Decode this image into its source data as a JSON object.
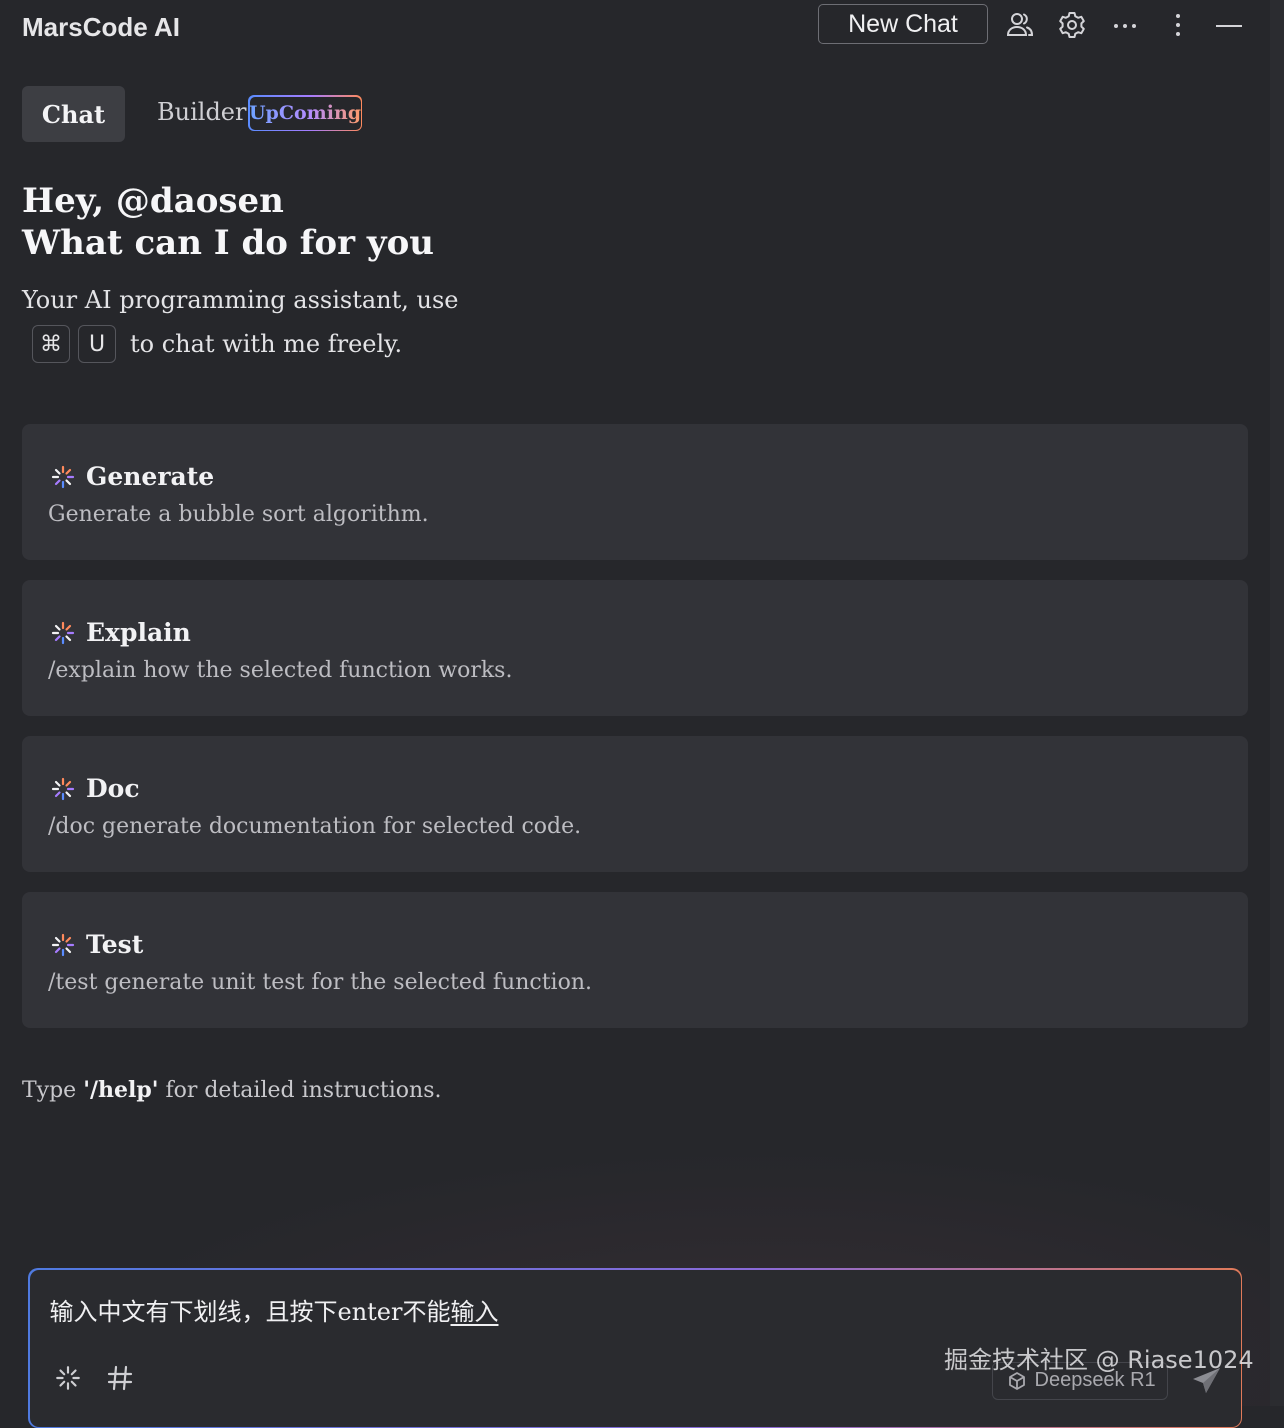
{
  "header": {
    "app_title": "MarsCode AI",
    "new_chat_label": "New Chat",
    "icons": [
      "people-icon",
      "gear-icon",
      "more-horizontal-icon",
      "more-vertical-icon",
      "minimize-icon"
    ]
  },
  "tabs": [
    {
      "label": "Chat",
      "active": true
    },
    {
      "label": "Builder",
      "active": false,
      "badge": "UpComing"
    }
  ],
  "hero": {
    "greeting": "Hey, @daosen",
    "question": "What can I do for you",
    "intro_line1": "Your AI programming assistant, use",
    "shortcut_keys": [
      "⌘",
      "U"
    ],
    "intro_line2": "to chat with me freely."
  },
  "cards": [
    {
      "title": "Generate",
      "description": "Generate a bubble sort algorithm."
    },
    {
      "title": "Explain",
      "description": "/explain how the selected function works."
    },
    {
      "title": "Doc",
      "description": "/doc generate documentation for selected code."
    },
    {
      "title": "Test",
      "description": "/test generate unit test for the selected function."
    }
  ],
  "help": {
    "prefix": "Type ",
    "command": "'/help'",
    "suffix": " for detailed instructions."
  },
  "input": {
    "value_committed": "输入中文有下划线，且按下enter不能",
    "value_composing": "输入",
    "model_label": "Deepseek R1"
  },
  "watermark": "掘金技术社区 @ Riase1024",
  "colors": {
    "background": "#26272b",
    "card": "#323338",
    "accent_blue": "#5a8cff",
    "accent_purple": "#a67cff",
    "accent_orange": "#ff8a5c"
  }
}
